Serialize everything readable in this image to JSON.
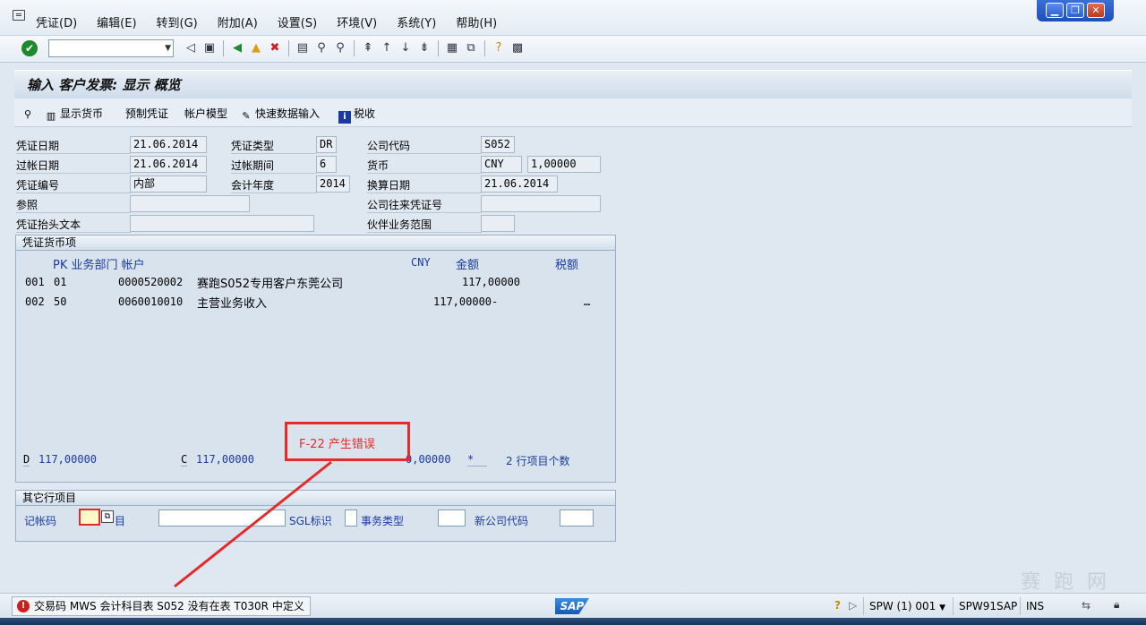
{
  "menu": [
    "凭证(D)",
    "编辑(E)",
    "转到(G)",
    "附加(A)",
    "设置(S)",
    "环境(V)",
    "系统(Y)",
    "帮助(H)"
  ],
  "window_controls": {
    "minimize": "▁",
    "restore": "❐",
    "close": "✕"
  },
  "toolbar": {
    "command_field_value": "",
    "icons": [
      "back-icon",
      "save-icon",
      "back-nav-icon",
      "exit-icon",
      "cancel-icon",
      "print-icon",
      "find-icon",
      "find-next-icon",
      "first-page-icon",
      "prev-page-icon",
      "next-page-icon",
      "last-page-icon",
      "create-session-icon",
      "shortcut-icon",
      "help-icon",
      "layout-icon"
    ]
  },
  "title": "输入 客户发票: 显示 概览",
  "app_toolbar": {
    "display_currency": "显示货币",
    "park": "预制凭证",
    "account_model": "帐户模型",
    "fast_entry": "快速数据输入",
    "tax": "税收"
  },
  "header": {
    "doc_date_label": "凭证日期",
    "doc_date": "21.06.2014",
    "doc_type_label": "凭证类型",
    "doc_type": "DR",
    "company_code_label": "公司代码",
    "company_code": "S052",
    "posting_date_label": "过帐日期",
    "posting_date": "21.06.2014",
    "period_label": "过帐期间",
    "period": "6",
    "currency_label": "货币",
    "currency": "CNY",
    "exchange_rate": "1,00000",
    "doc_number_label": "凭证编号",
    "doc_number": "内部",
    "fiscal_year_label": "会计年度",
    "fiscal_year": "2014",
    "translation_date_label": "换算日期",
    "translation_date": "21.06.2014",
    "reference_label": "参照",
    "cross_cc_label": "公司往来凭证号",
    "header_text_label": "凭证抬头文本",
    "trading_partner_label": "伙伴业务范围"
  },
  "items_group": {
    "title": "凭证货币项",
    "col_pk": "PK 业务部门 帐户",
    "col_cny": "CNY",
    "col_amount": "金额",
    "col_tax": "税额",
    "rows": [
      {
        "no": "001",
        "pk": "01",
        "account": "0000520002",
        "name": "赛跑S052专用客户东莞公司",
        "amount": "117,00000",
        "tax": ""
      },
      {
        "no": "002",
        "pk": "50",
        "account": "0060010010",
        "name": "主营业务收入",
        "amount": "117,00000-",
        "tax": "…"
      }
    ],
    "debit_label": "D",
    "debit": "117,00000",
    "credit_label": "C",
    "credit": "117,00000",
    "balance": "0,00000",
    "balance_flag": "*",
    "item_count": "2 行项目个数"
  },
  "annotation": "F-22  产生错误",
  "other_group": {
    "title": "其它行项目",
    "posting_key_label": "记帐码",
    "account_label": "目",
    "sgl_label": "SGL标识",
    "trans_type_label": "事务类型",
    "new_cc_label": "新公司代码"
  },
  "status": {
    "message": "交易码 MWS 会计科目表 S052 没有在表 T030R 中定义",
    "sap_logo": "SAP",
    "system": "SPW (1) 001",
    "server": "SPW91SAP",
    "mode": "INS"
  },
  "watermark": "赛 跑 网",
  "colors": {
    "error": "#d21d1d",
    "annotation": "#e52a2a",
    "field_blue": "#1a3aa0"
  }
}
